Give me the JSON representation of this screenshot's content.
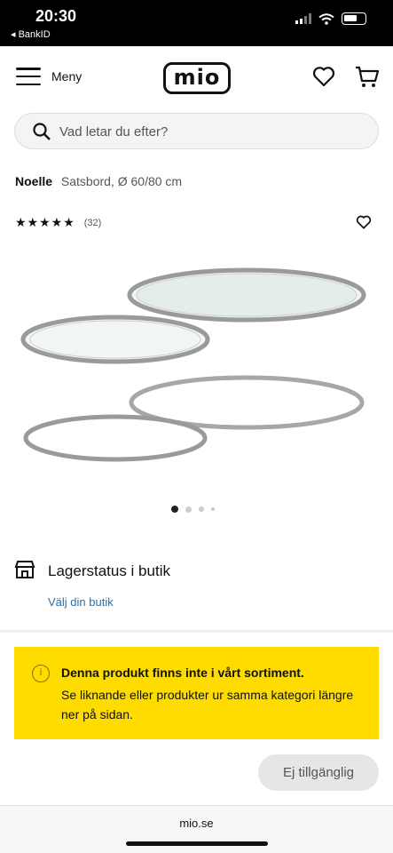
{
  "status_bar": {
    "time": "20:30",
    "back_app": "◂ BankID"
  },
  "header": {
    "menu_label": "Meny",
    "logo_text": "mio"
  },
  "search": {
    "placeholder": "Vad letar du efter?"
  },
  "product": {
    "brand": "Noelle",
    "subtitle": "Satsbord, Ø 60/80 cm",
    "stars": "★★★★★",
    "rating_value": 5,
    "review_count": "(32)",
    "image_dots": {
      "count": 4,
      "active_index": 0
    }
  },
  "store_status": {
    "title": "Lagerstatus i butik",
    "link": "Välj din butik"
  },
  "notice": {
    "icon": "i",
    "title": "Denna produkt finns inte i vårt sortiment.",
    "body": "Se liknande eller produkter ur samma kategori längre ner på sidan."
  },
  "unavailable_button": "Ej tillgänglig",
  "browser": {
    "url": "mio.se"
  },
  "colors": {
    "notice_bg": "#ffdc00",
    "link": "#2a6fa8",
    "disabled_button": "#e6e6e6"
  },
  "icons": [
    "signal-icon",
    "wifi-icon",
    "battery-icon",
    "hamburger-icon",
    "heart-icon",
    "cart-icon",
    "search-icon",
    "store-icon",
    "info-icon"
  ]
}
